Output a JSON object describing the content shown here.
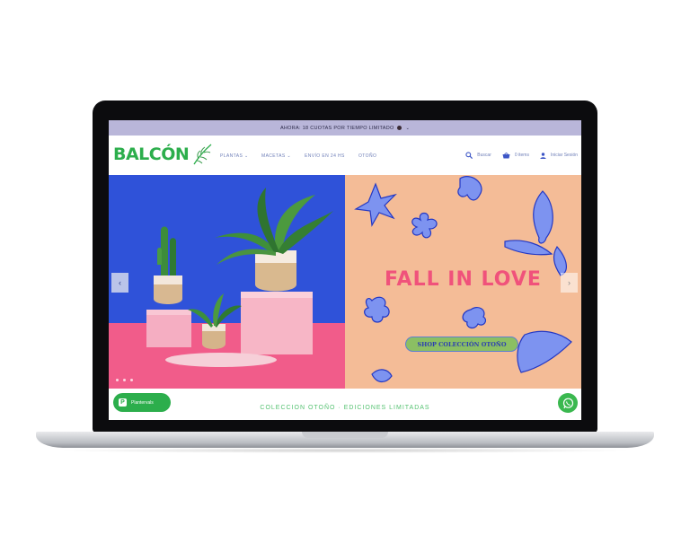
{
  "announcement": {
    "text": "AHORA: 18 CUOTAS POR TIEMPO LIMITADO"
  },
  "header": {
    "logo_text": "BALCÓN",
    "nav": [
      "PLANTAS ⌄",
      "MACETAS ⌄",
      "ENVÍO EN 24 HS",
      "OTOÑO"
    ],
    "search_label": "Buscar",
    "cart_label": "0 items",
    "login_label": "Iniciar Sesión"
  },
  "hero": {
    "headline": "FALL IN LOVE",
    "cta_label": "SHOP COLECCIÓN OTOÑO",
    "prev_arrow": "‹",
    "next_arrow": "›"
  },
  "bottom": {
    "collection_text": "COLECCION OTOÑO · EDICIONES LIMITADAS",
    "plant_button_label": "Plantervals"
  },
  "colors": {
    "brand_green": "#2cae4c",
    "announce_bg": "#b9b6d9",
    "hero_blue": "#2f52d9",
    "hero_peach": "#f4bc97",
    "headline_pink": "#f0527b",
    "cta_green": "#8bbf63"
  }
}
